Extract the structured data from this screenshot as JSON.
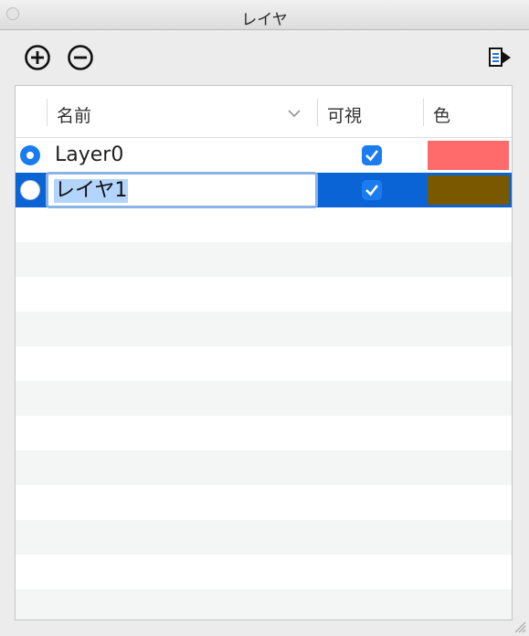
{
  "window": {
    "title": "レイヤ"
  },
  "toolbar": {
    "add_icon": "plus-circle-icon",
    "remove_icon": "minus-circle-icon",
    "export_icon": "export-arrow-icon"
  },
  "table": {
    "columns": {
      "name": "名前",
      "visible": "可視",
      "color": "色"
    },
    "sort_icon": "chevron-down-icon",
    "rows": [
      {
        "active": true,
        "name": "Layer0",
        "visible": true,
        "color": "#ff6b6b"
      },
      {
        "active": false,
        "name": "レイヤ1",
        "visible": true,
        "color": "#7a5800",
        "selected": true,
        "editing": true
      }
    ]
  },
  "colors": {
    "selection": "#0a64d6",
    "accent": "#1b7cf0"
  }
}
